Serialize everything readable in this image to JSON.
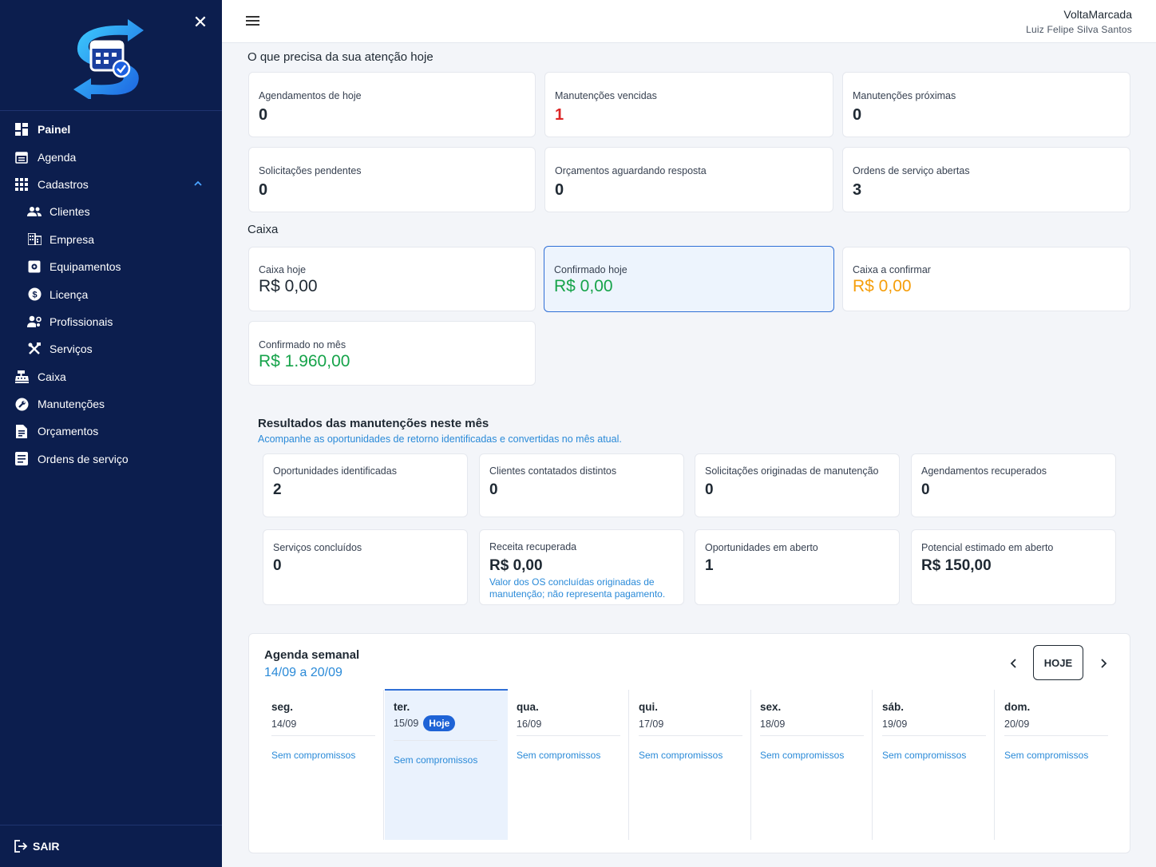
{
  "sidebar": {
    "logo_icon": "calendar-sync-logo",
    "close_icon": "close-icon",
    "items": [
      {
        "label": "Painel",
        "icon": "dashboard-icon"
      },
      {
        "label": "Agenda",
        "icon": "calendar-icon"
      },
      {
        "label": "Cadastros",
        "icon": "grid-icon",
        "expanded": true
      },
      {
        "label": "Clientes",
        "icon": "users-icon"
      },
      {
        "label": "Empresa",
        "icon": "building-icon"
      },
      {
        "label": "Equipamentos",
        "icon": "device-icon"
      },
      {
        "label": "Licença",
        "icon": "dollar-circle-icon"
      },
      {
        "label": "Profissionais",
        "icon": "user-gear-icon"
      },
      {
        "label": "Serviços",
        "icon": "tools-icon"
      },
      {
        "label": "Caixa",
        "icon": "cash-register-icon"
      },
      {
        "label": "Manutenções",
        "icon": "wrench-icon"
      },
      {
        "label": "Orçamentos",
        "icon": "document-icon"
      },
      {
        "label": "Ordens de serviço",
        "icon": "list-doc-icon"
      }
    ],
    "logout_label": "SAIR"
  },
  "header": {
    "company": "VoltaMarcada",
    "user": "Luiz Felipe Silva Santos"
  },
  "attention": {
    "title": "O que precisa da sua atenção hoje",
    "cards": [
      {
        "label": "Agendamentos de hoje",
        "value": "0"
      },
      {
        "label": "Manutenções vencidas",
        "value": "1"
      },
      {
        "label": "Manutenções próximas",
        "value": "0"
      },
      {
        "label": "Solicitações pendentes",
        "value": "0"
      },
      {
        "label": "Orçamentos aguardando resposta",
        "value": "0"
      },
      {
        "label": "Ordens de serviço abertas",
        "value": "3"
      }
    ]
  },
  "caixa": {
    "title": "Caixa",
    "cards": [
      {
        "label": "Caixa hoje",
        "value": "R$ 0,00"
      },
      {
        "label": "Confirmado hoje",
        "value": "R$ 0,00"
      },
      {
        "label": "Caixa a confirmar",
        "value": "R$ 0,00"
      },
      {
        "label": "Confirmado no mês",
        "value": "R$ 1.960,00"
      }
    ]
  },
  "results": {
    "title": "Resultados das manutenções neste mês",
    "subtitle": "Acompanhe as oportunidades de retorno identificadas e convertidas no mês atual.",
    "cards": [
      {
        "label": "Oportunidades identificadas",
        "value": "2"
      },
      {
        "label": "Clientes contatados distintos",
        "value": "0"
      },
      {
        "label": "Solicitações originadas de manutenção",
        "value": "0"
      },
      {
        "label": "Agendamentos recuperados",
        "value": "0"
      },
      {
        "label": "Serviços concluídos",
        "value": "0"
      },
      {
        "label": "Receita recuperada",
        "value": "R$ 0,00",
        "note": "Valor dos OS concluídas originadas de manutenção; não representa pagamento."
      },
      {
        "label": "Oportunidades em aberto",
        "value": "1"
      },
      {
        "label": "Potencial estimado em aberto",
        "value": "R$ 150,00"
      }
    ]
  },
  "agenda": {
    "title": "Agenda semanal",
    "range": "14/09 a 20/09",
    "today_button": "HOJE",
    "today_badge": "Hoje",
    "days": [
      {
        "name": "seg.",
        "date": "14/09",
        "empty": "Sem compromissos"
      },
      {
        "name": "ter.",
        "date": "15/09",
        "empty": "Sem compromissos",
        "is_today": true
      },
      {
        "name": "qua.",
        "date": "16/09",
        "empty": "Sem compromissos"
      },
      {
        "name": "qui.",
        "date": "17/09",
        "empty": "Sem compromissos"
      },
      {
        "name": "sex.",
        "date": "18/09",
        "empty": "Sem compromissos"
      },
      {
        "name": "sáb.",
        "date": "19/09",
        "empty": "Sem compromissos"
      },
      {
        "name": "dom.",
        "date": "20/09",
        "empty": "Sem compromissos"
      }
    ]
  },
  "colors": {
    "sidebar_bg": "#0c1e4e",
    "accent": "#2f6fd6",
    "danger": "#dc2626",
    "success": "#16a34a",
    "warning": "#f59e0b",
    "link": "#2a8ad8"
  }
}
